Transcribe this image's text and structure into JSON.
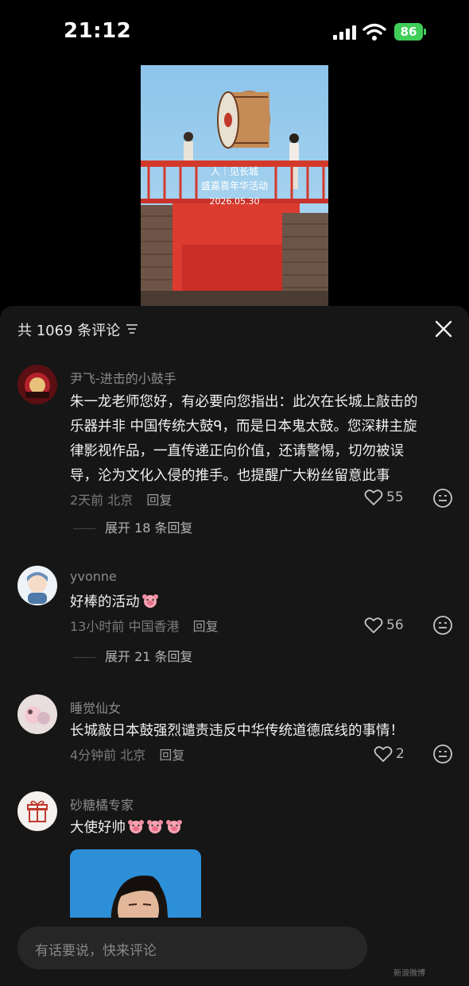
{
  "status_bar": {
    "time": "21:12",
    "battery": "86"
  },
  "video": {
    "overlay_lines": [
      "人｜见长城",
      "盛嘉喜年华活动",
      "2026.05.30"
    ]
  },
  "sheet": {
    "title": "共 1069 条评论",
    "comments": [
      {
        "username": "尹飞-进击的小鼓手",
        "lines": [
          "朱一龙老师您好，有必要向您指出：此次在长城上敲击的",
          "乐器并非 中国传统大鼓ᑫ，而是日本鬼太鼓。您深耕主旋",
          "律影视作品，一直传递正向价值，还请警惕，切勿被误",
          "导，沦为文化入侵的推手。也提醒广大粉丝留意此事"
        ],
        "time": "2天前",
        "location": "北京",
        "reply_label": "回复",
        "likes": "55",
        "expand": "展开 18 条回复"
      },
      {
        "username": "yvonne",
        "text": "好棒的活动",
        "time": "13小时前",
        "location": "中国香港",
        "reply_label": "回复",
        "likes": "56",
        "expand": "展开 21 条回复"
      },
      {
        "username": "睡觉仙女",
        "text": "长城敲日本鼓强烈谴责违反中华传统道德底线的事情！",
        "time": "4分钟前",
        "location": "北京",
        "reply_label": "回复",
        "likes": "2"
      },
      {
        "username": "砂糖橘专家",
        "text": "大使好帅"
      }
    ]
  },
  "input": {
    "placeholder": "有话要说，快来评论"
  },
  "watermark": "新浪微博",
  "colors": {
    "accent_battery": "#3fcf58",
    "sheet_bg": "#161616",
    "input_bg": "#262626"
  }
}
